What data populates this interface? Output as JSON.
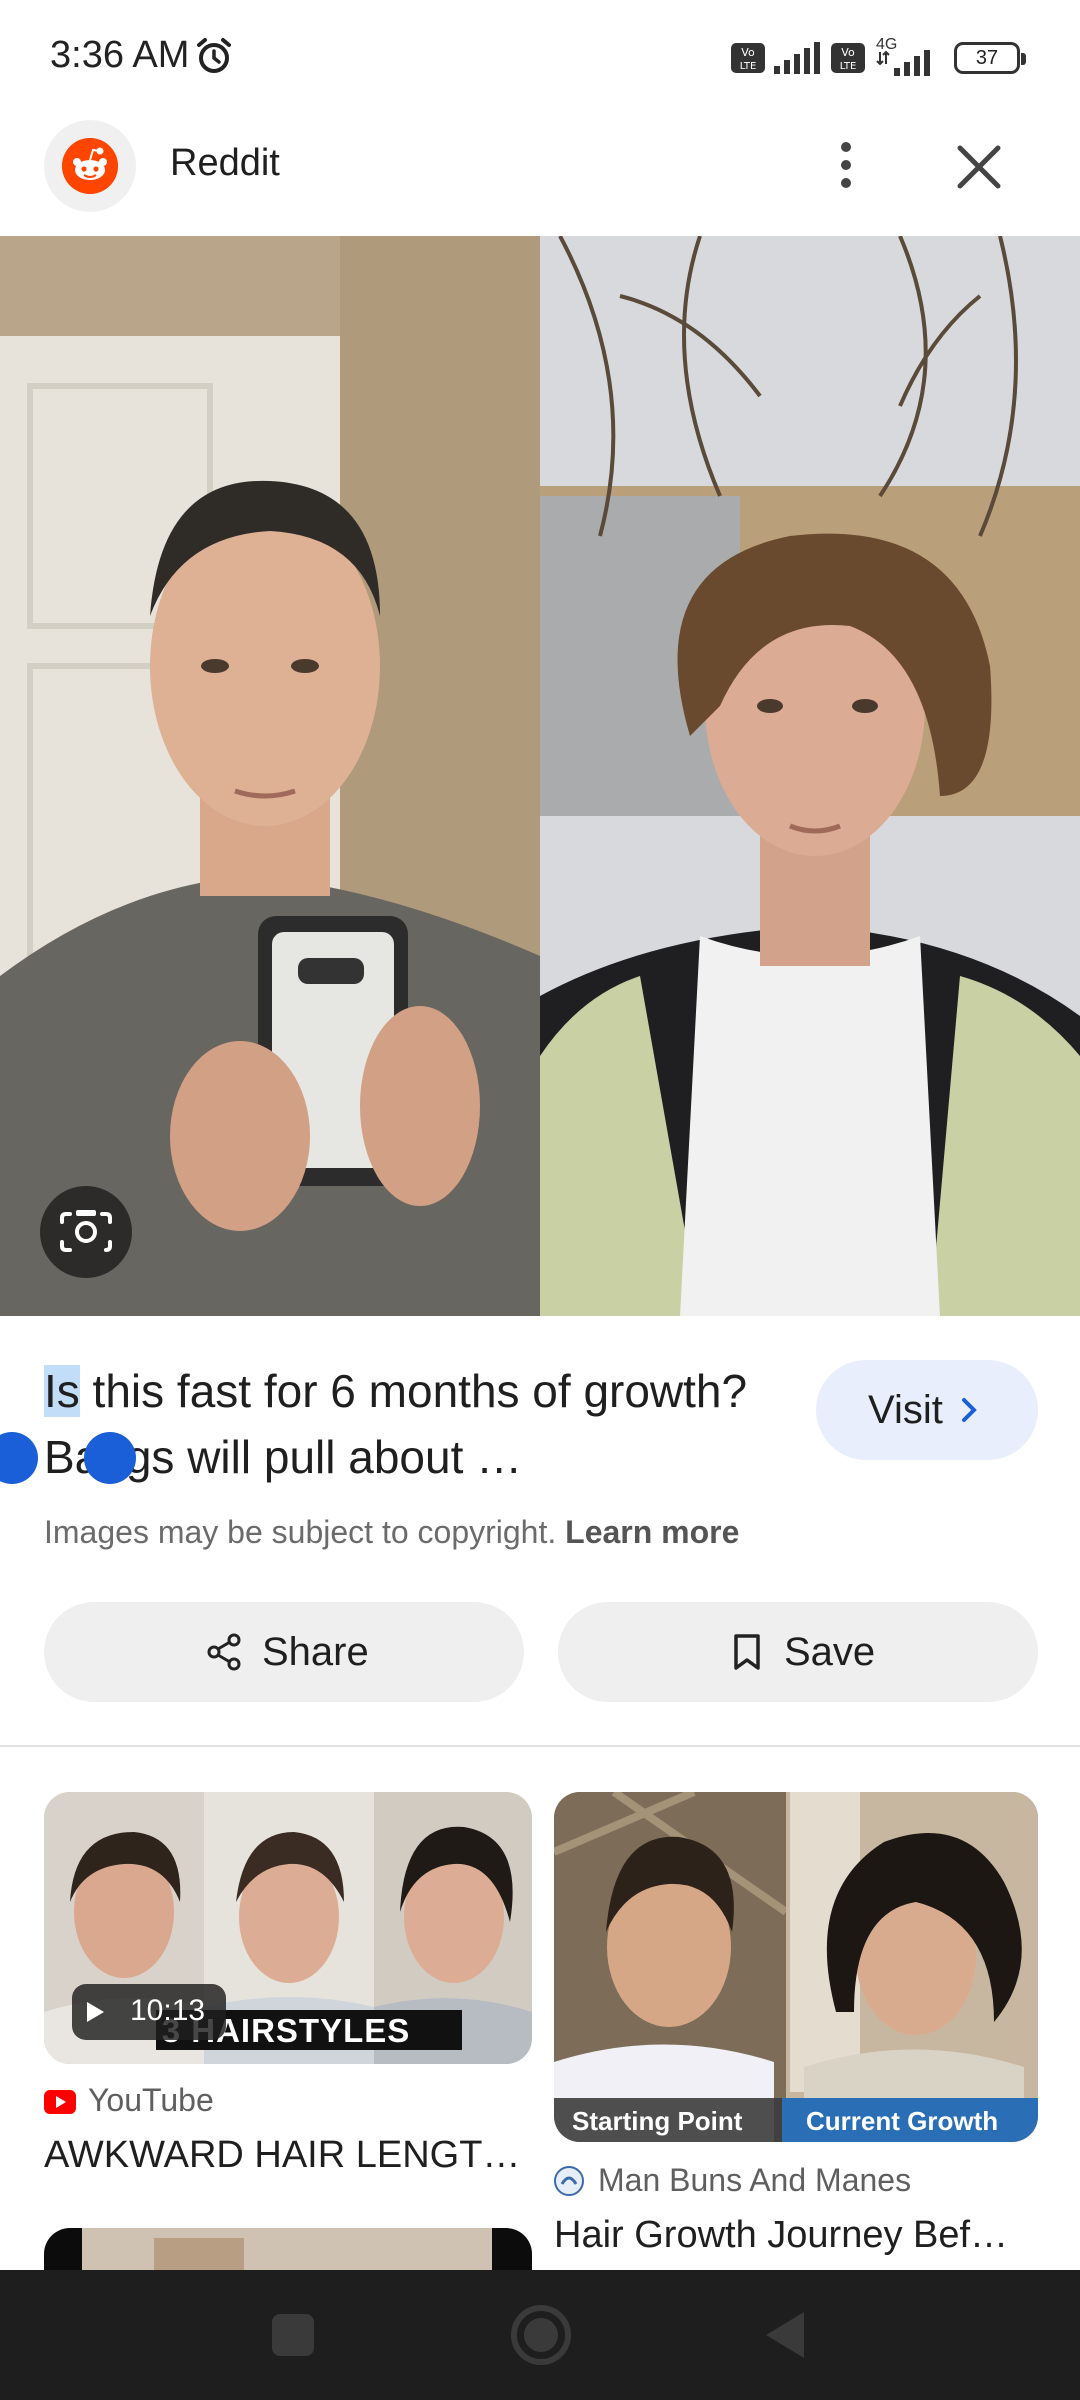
{
  "status_bar": {
    "time": "3:36 AM",
    "network_type": "4G",
    "volte_label_1": "Vo LTE",
    "volte_label_2": "Vo LTE",
    "battery": "37",
    "icons": [
      "alarm-icon",
      "volte-icon",
      "signal-icon",
      "volte-icon",
      "signal-4g-icon",
      "battery-icon"
    ]
  },
  "header": {
    "site_name": "Reddit",
    "icons": [
      "reddit-logo-icon",
      "more-vert-icon",
      "close-icon"
    ]
  },
  "image": {
    "lens_icon": "google-lens-icon"
  },
  "result": {
    "title_selected": "Is",
    "title_rest": " this fast for 6 months of growth? Bangs will pull about …",
    "visit_label": "Visit",
    "copyright_text": "Images may be subject to copyright.",
    "learn_more": "Learn more",
    "share_label": "Share",
    "save_label": "Save",
    "share_icon": "share-icon",
    "save_icon": "bookmark-icon"
  },
  "related": [
    {
      "duration": "10:13",
      "overlay_text": "3 HAIRSTYLES",
      "source": "YouTube",
      "title": "AWKWARD HAIR LENGT…",
      "source_icon": "youtube-icon"
    },
    {
      "left_label": "Starting Point",
      "right_label": "Current Growth",
      "source": "Man Buns And Manes",
      "title": "Hair Growth Journey Bef…",
      "source_icon": "site-favicon-icon"
    }
  ],
  "colors": {
    "selection": "#c2ddf7",
    "handle": "#1a5fd8",
    "visit_bg": "#e8eefb",
    "reddit": "#ff4500",
    "growth_label_bg": "#2a6fb5"
  }
}
